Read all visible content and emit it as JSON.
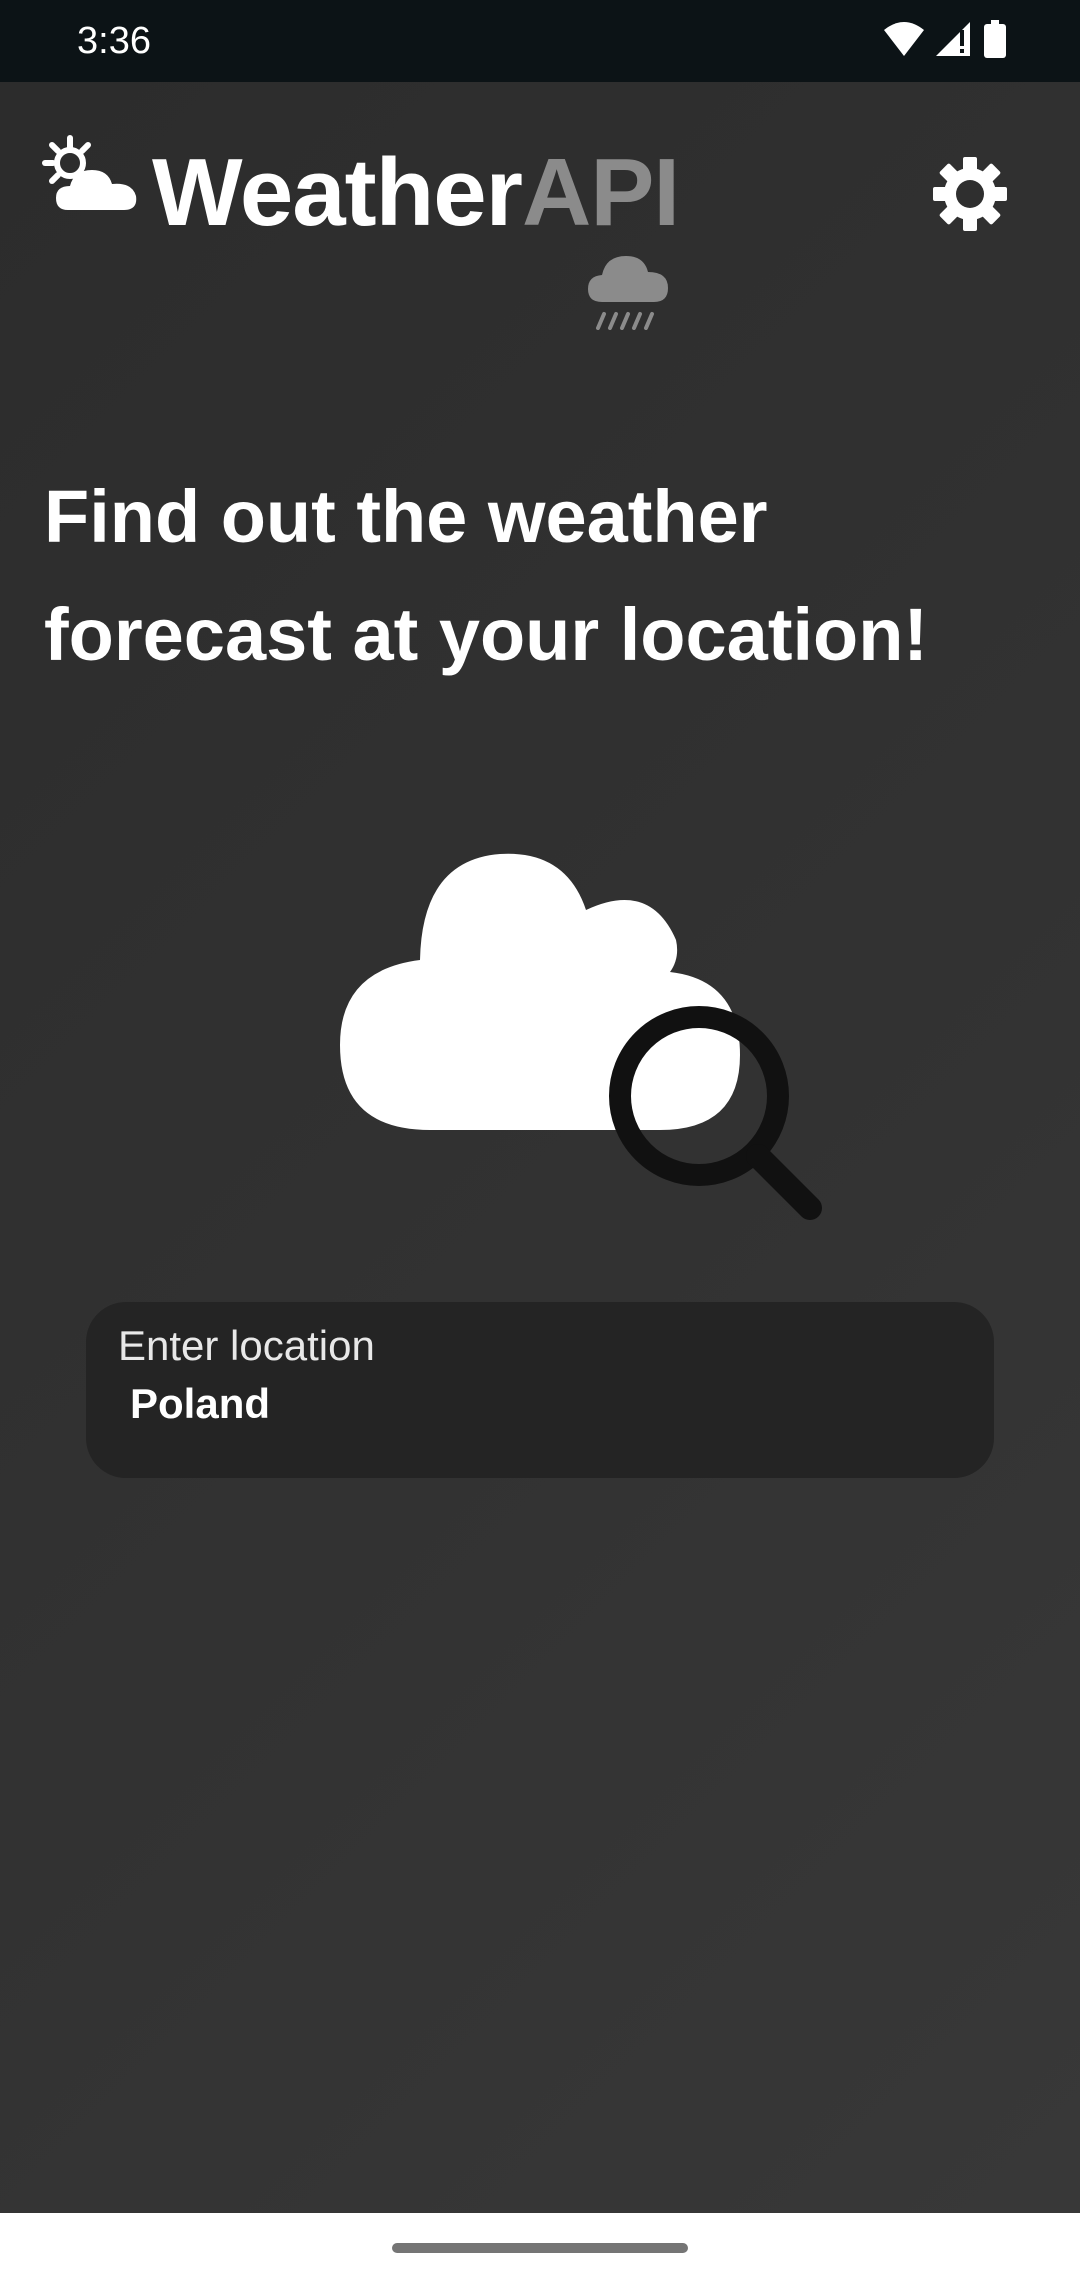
{
  "status_bar": {
    "time": "3:36",
    "icons": [
      "wifi-icon",
      "cellular-signal-icon",
      "battery-icon"
    ]
  },
  "header": {
    "brand_primary": "Weather",
    "brand_secondary": "API",
    "logo_icon": "partly-cloudy-icon",
    "rain_icon": "cloud-rain-icon",
    "settings_icon": "gear-icon"
  },
  "main": {
    "headline": "Find out the weather forecast at your location!",
    "illustration_icon": "cloud-search-icon",
    "location_input": {
      "label": "Enter location",
      "value": "Poland"
    }
  },
  "colors": {
    "background": "#2f2f2f",
    "status_bar": "#0c1316",
    "text_primary": "#ffffff",
    "brand_accent": "#8b8b8b",
    "input_background": "#242424"
  }
}
